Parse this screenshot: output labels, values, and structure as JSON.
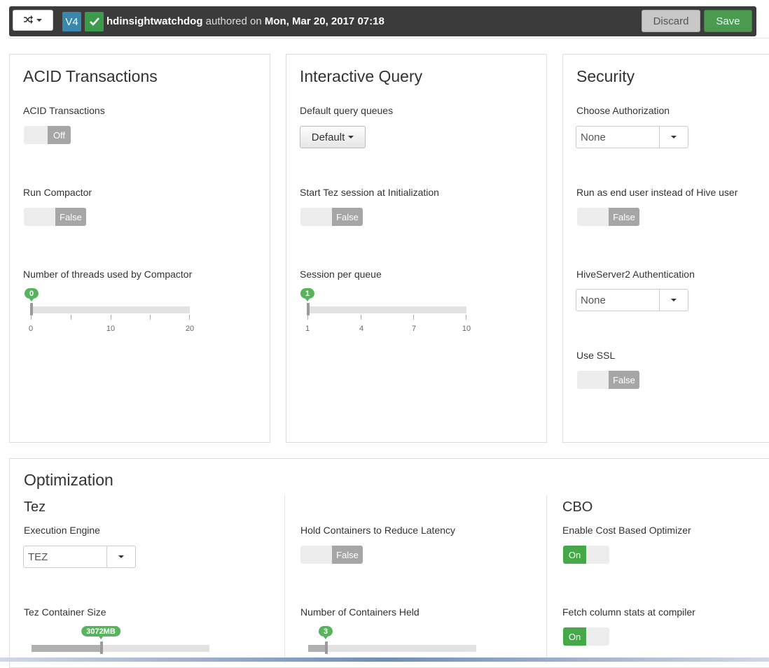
{
  "topbar": {
    "version": "V4",
    "author": "hdinsightwatchdog",
    "authored_text": " authored on ",
    "date": "Mon, Mar 20, 2017 07:18",
    "discard_label": "Discard",
    "save_label": "Save"
  },
  "acid": {
    "title": "ACID Transactions",
    "acid_label": "ACID Transactions",
    "acid_value": "Off",
    "compactor_label": "Run Compactor",
    "compactor_value": "False",
    "threads_label": "Number of threads used by Compactor",
    "threads_value": "0",
    "threads_fraction": 0,
    "threads_ticks": [
      "0",
      "10",
      "20"
    ]
  },
  "interactive": {
    "title": "Interactive Query",
    "queues_label": "Default query queues",
    "queues_value": "Default",
    "tez_session_label": "Start Tez session at Initialization",
    "tez_session_value": "False",
    "session_label": "Session per queue",
    "session_value": "1",
    "session_fraction": 0,
    "session_ticks": [
      "1",
      "4",
      "7",
      "10"
    ]
  },
  "security": {
    "title": "Security",
    "auth_label": "Choose Authorization",
    "auth_value": "None",
    "end_user_label": "Run as end user instead of Hive user",
    "end_user_value": "False",
    "hs2_label": "HiveServer2 Authentication",
    "hs2_value": "None",
    "ssl_label": "Use SSL",
    "ssl_value": "False"
  },
  "optimization": {
    "title": "Optimization",
    "tez_heading": "Tez",
    "engine_label": "Execution Engine",
    "engine_value": "TEZ",
    "container_size_label": "Tez Container Size",
    "container_size_value": "3072MB",
    "container_size_fraction": 0.4,
    "hold_label": "Hold Containers to Reduce Latency",
    "hold_value": "False",
    "held_label": "Number of Containers Held",
    "held_value": "3",
    "held_fraction": 0.1,
    "cbo_heading": "CBO",
    "cbo_label": "Enable Cost Based Optimizer",
    "cbo_value": "On",
    "colstats_label": "Fetch column stats at compiler",
    "colstats_value": "On"
  }
}
